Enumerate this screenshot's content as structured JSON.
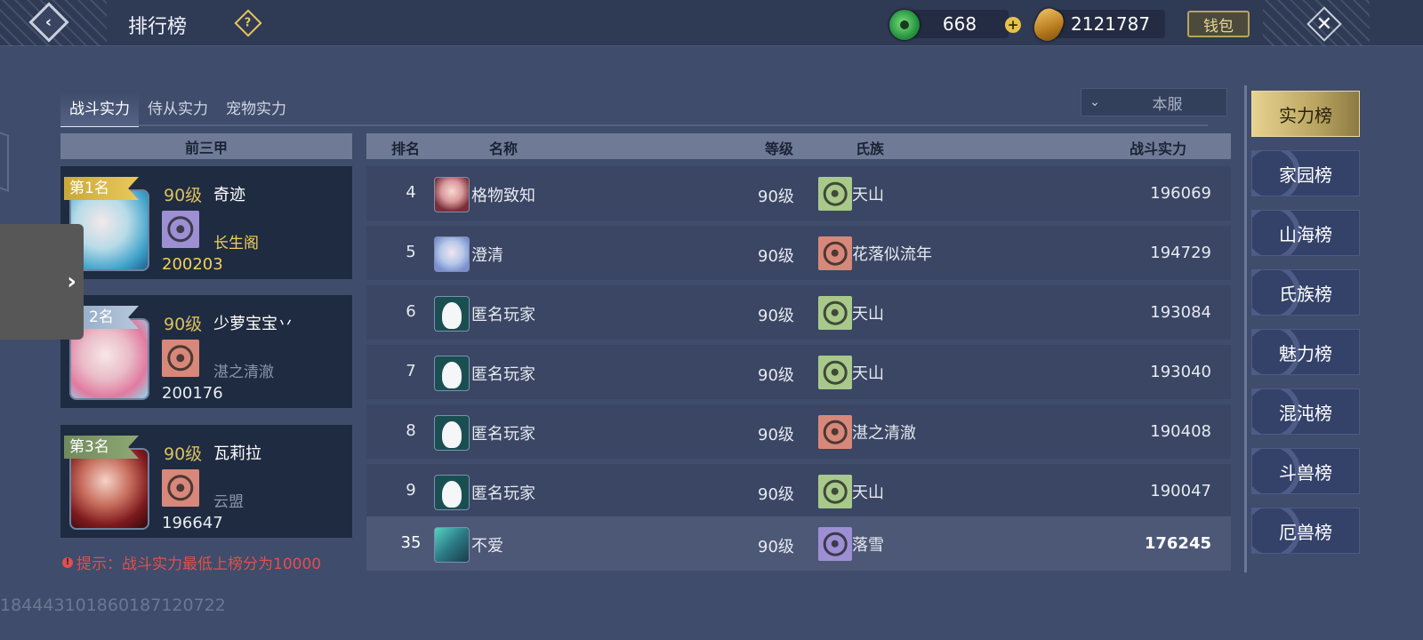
{
  "header": {
    "title": "排行榜",
    "currency_jade": "668",
    "currency_coin": "2121787",
    "wallet_label": "钱包"
  },
  "tabs": [
    {
      "label": "战斗实力",
      "active": true
    },
    {
      "label": "侍从实力",
      "active": false
    },
    {
      "label": "宠物实力",
      "active": false
    }
  ],
  "server_filter": {
    "selected": "本服"
  },
  "top3": {
    "header": "前三甲",
    "entries": [
      {
        "rank_label": "第1名",
        "level": "90级",
        "name": "奇迹",
        "clan": "长生阁",
        "power": "200203",
        "badge_color": "#9c8fd3"
      },
      {
        "rank_label": "2名",
        "level": "90级",
        "name": "少萝宝宝丷",
        "clan": "湛之清澈",
        "power": "200176",
        "badge_color": "#d7887a"
      },
      {
        "rank_label": "第3名",
        "level": "90级",
        "name": "瓦莉拉",
        "clan": "云盟",
        "power": "196647",
        "badge_color": "#d7887a"
      }
    ]
  },
  "hint": "提示：战斗实力最低上榜分为10000",
  "table": {
    "columns": [
      "排名",
      "名称",
      "等级",
      "氏族",
      "战斗实力"
    ],
    "rows": [
      {
        "rank": "4",
        "name": "格物致知",
        "level": "90级",
        "clan": "天山",
        "power": "196069",
        "avatar": "portrait",
        "badge": "green"
      },
      {
        "rank": "5",
        "name": "澄清",
        "level": "90级",
        "clan": "花落似流年",
        "power": "194729",
        "avatar": "portrait",
        "badge": "red"
      },
      {
        "rank": "6",
        "name": "匿名玩家",
        "level": "90级",
        "clan": "天山",
        "power": "193084",
        "avatar": "anonymous",
        "badge": "green"
      },
      {
        "rank": "7",
        "name": "匿名玩家",
        "level": "90级",
        "clan": "天山",
        "power": "193040",
        "avatar": "anonymous",
        "badge": "green"
      },
      {
        "rank": "8",
        "name": "匿名玩家",
        "level": "90级",
        "clan": "湛之清澈",
        "power": "190408",
        "avatar": "anonymous",
        "badge": "red"
      },
      {
        "rank": "9",
        "name": "匿名玩家",
        "level": "90级",
        "clan": "天山",
        "power": "190047",
        "avatar": "anonymous",
        "badge": "green"
      }
    ],
    "my_row": {
      "rank": "35",
      "name": "不爱",
      "level": "90级",
      "clan": "落雪",
      "power": "176245",
      "avatar": "portrait",
      "badge": "purple"
    }
  },
  "side_nav": [
    {
      "label": "实力榜",
      "active": true
    },
    {
      "label": "家园榜",
      "active": false
    },
    {
      "label": "山海榜",
      "active": false
    },
    {
      "label": "氏族榜",
      "active": false
    },
    {
      "label": "魅力榜",
      "active": false
    },
    {
      "label": "混沌榜",
      "active": false
    },
    {
      "label": "斗兽榜",
      "active": false
    },
    {
      "label": "厄兽榜",
      "active": false
    }
  ],
  "uid": "184443101860187120722",
  "colors": {
    "gold_text": "#f0d15a",
    "hint_red": "#e04f4f",
    "badge_green": "#a8c98a",
    "badge_red": "#d7887a",
    "badge_purple": "#9c8fd3"
  }
}
